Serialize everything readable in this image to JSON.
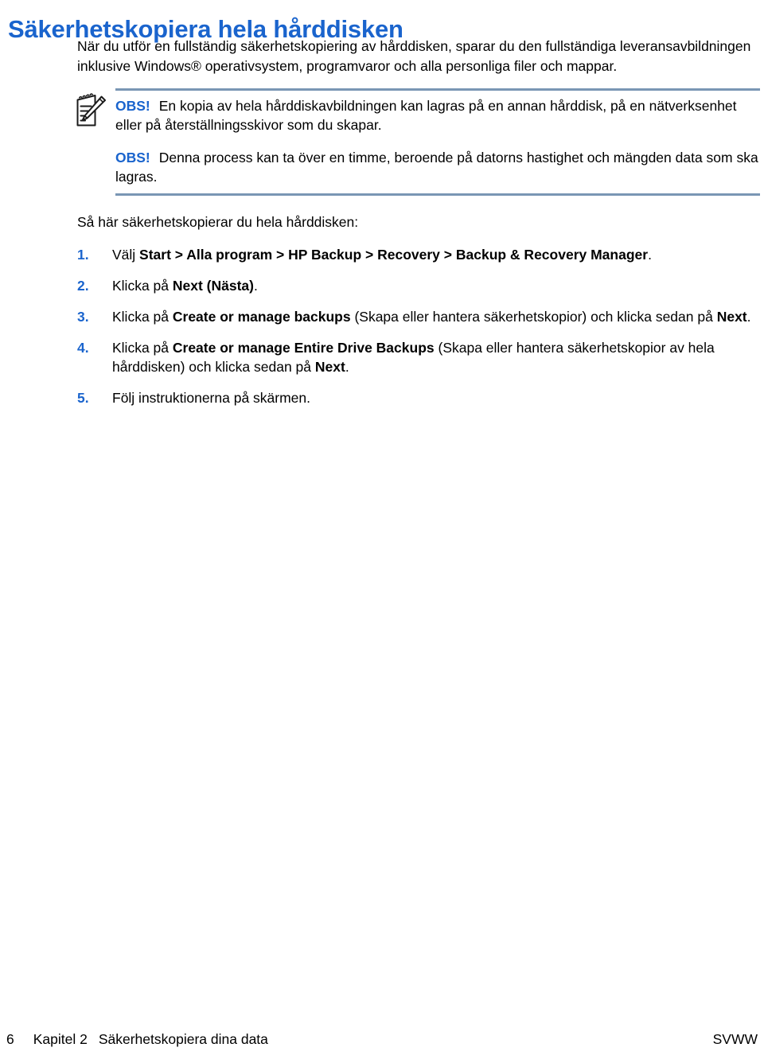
{
  "colors": {
    "heading_blue": "#1a64cd",
    "rule_blue": "#7a96b4",
    "body_black": "#000000"
  },
  "title": "Säkerhetskopiera hela hårddisken",
  "intro": "När du utför en fullständig säkerhetskopiering av hårddisken, sparar du den fullständiga leveransavbildningen inklusive Windows® operativsystem, programvaror och alla personliga filer och mappar.",
  "note": {
    "icon_name": "note-pencil-icon",
    "label": "OBS!",
    "paragraphs": [
      "En kopia av hela hårddiskavbildningen kan lagras på en annan hårddisk, på en nätverksenhet eller på återställningsskivor som du skapar.",
      "Denna process kan ta över en timme, beroende på datorns hastighet och mängden data som ska lagras."
    ]
  },
  "lead_in": "Så här säkerhetskopierar du hela hårddisken:",
  "steps": [
    {
      "number": "1.",
      "parts": [
        {
          "text": "Välj ",
          "bold": false
        },
        {
          "text": "Start > Alla program > HP Backup > Recovery > Backup & Recovery Manager",
          "bold": true
        },
        {
          "text": ".",
          "bold": false
        }
      ]
    },
    {
      "number": "2.",
      "parts": [
        {
          "text": "Klicka på ",
          "bold": false
        },
        {
          "text": "Next (Nästa)",
          "bold": true
        },
        {
          "text": ".",
          "bold": false
        }
      ]
    },
    {
      "number": "3.",
      "parts": [
        {
          "text": "Klicka på ",
          "bold": false
        },
        {
          "text": "Create or manage backups",
          "bold": true
        },
        {
          "text": " (Skapa eller hantera säkerhetskopior) och klicka sedan på ",
          "bold": false
        },
        {
          "text": "Next",
          "bold": true
        },
        {
          "text": ".",
          "bold": false
        }
      ]
    },
    {
      "number": "4.",
      "parts": [
        {
          "text": "Klicka på ",
          "bold": false
        },
        {
          "text": "Create or manage Entire Drive Backups",
          "bold": true
        },
        {
          "text": " (Skapa eller hantera säkerhetskopior av hela hårddisken) och klicka sedan på ",
          "bold": false
        },
        {
          "text": "Next",
          "bold": true
        },
        {
          "text": ".",
          "bold": false
        }
      ]
    },
    {
      "number": "5.",
      "parts": [
        {
          "text": "Följ instruktionerna på skärmen.",
          "bold": false
        }
      ]
    }
  ],
  "footer": {
    "page_number": "6",
    "chapter": "Kapitel 2",
    "chapter_title": "Säkerhetskopiera dina data",
    "right": "SVWW"
  }
}
